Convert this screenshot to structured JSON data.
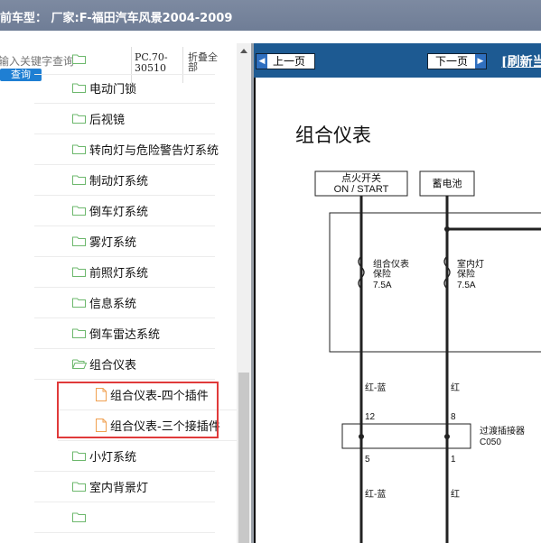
{
  "header": {
    "title": "前车型：  厂家:F-福田汽车风景2004-2009"
  },
  "search": {
    "placeholder": "输入关键字查询",
    "query_button": "查询",
    "pc_code": "PC.70-30510",
    "collapse_all": "折叠全部"
  },
  "tree": {
    "items": [
      {
        "label": "",
        "type": "folder"
      },
      {
        "label": "电动门锁",
        "type": "folder"
      },
      {
        "label": "后视镜",
        "type": "folder"
      },
      {
        "label": "转向灯与危险警告灯系统",
        "type": "folder"
      },
      {
        "label": "制动灯系统",
        "type": "folder"
      },
      {
        "label": "倒车灯系统",
        "type": "folder"
      },
      {
        "label": "雾灯系统",
        "type": "folder"
      },
      {
        "label": "前照灯系统",
        "type": "folder"
      },
      {
        "label": "信息系统",
        "type": "folder"
      },
      {
        "label": "倒车雷达系统",
        "type": "folder"
      },
      {
        "label": "组合仪表",
        "type": "folder-open"
      },
      {
        "label": "组合仪表-四个插件",
        "type": "file"
      },
      {
        "label": "组合仪表-三个接插件",
        "type": "file"
      },
      {
        "label": "小灯系统",
        "type": "folder"
      },
      {
        "label": "室内背景灯",
        "type": "folder"
      },
      {
        "label": "",
        "type": "folder"
      }
    ]
  },
  "viewer": {
    "prev_label": "上一页",
    "next_label": "下一页",
    "refresh_label": "[刷新当",
    "diagram": {
      "title": "组合仪表",
      "box_ignition_1": "点火开关",
      "box_ignition_2": "ON / START",
      "box_battery": "蓄电池",
      "fuse1_1": "组合仪表",
      "fuse1_2": "保险",
      "fuse1_3": "7.5A",
      "fuse2_1": "室内灯",
      "fuse2_2": "保险",
      "fuse2_3": "7.5A",
      "wire_left": "红-蓝",
      "wire_right": "红",
      "pin_top_left": "12",
      "pin_top_right": "8",
      "connector_name": "过渡插接器",
      "connector_code": "C050",
      "pin_bottom_left": "5",
      "pin_bottom_right": "1",
      "wire_left_2": "红-蓝",
      "wire_right_2": "红"
    }
  },
  "colors": {
    "header_bg": "#7485a0",
    "nav_bg": "#1d5a92",
    "highlight": "#e03a3a",
    "query_btn": "#1f7fd3"
  }
}
